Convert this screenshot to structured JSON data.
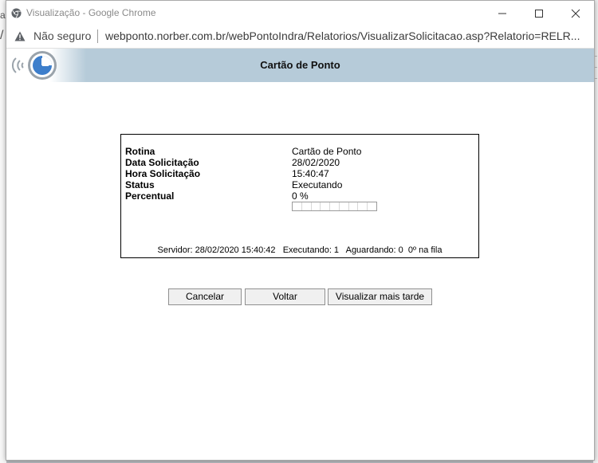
{
  "browser": {
    "window_title": "Visualização - Google Chrome",
    "security_label": "Não seguro",
    "url": "webponto.norber.com.br/webPontoIndra/Relatorios/VisualizarSolicitacao.asp?Relatorio=RELR..."
  },
  "background": {
    "glyph1": "a",
    "glyph2": "/"
  },
  "header": {
    "title": "Cartão de Ponto",
    "colors": {
      "band": "#b6cbd9",
      "logo_ring": "#3d7ecb"
    }
  },
  "info": {
    "rows": [
      {
        "label": "Rotina",
        "value": "Cartão de Ponto"
      },
      {
        "label": "Data Solicitação",
        "value": "28/02/2020"
      },
      {
        "label": "Hora Solicitação",
        "value": "15:40:47"
      },
      {
        "label": "Status",
        "value": "Executando"
      },
      {
        "label": "Percentual",
        "value": "0 %"
      }
    ],
    "progress_percent": 0,
    "server_line": "Servidor: 28/02/2020 15:40:42   Executando: 1   Aguardando: 0  0º na fila"
  },
  "buttons": {
    "cancel": "Cancelar",
    "back": "Voltar",
    "later": "Visualizar mais tarde"
  },
  "icons": {
    "chrome": "chrome-logo-icon",
    "minimize": "minimize-icon",
    "maximize": "maximize-icon",
    "close": "close-icon",
    "warning": "warning-icon",
    "logo": "norber-clock-logo-icon"
  }
}
